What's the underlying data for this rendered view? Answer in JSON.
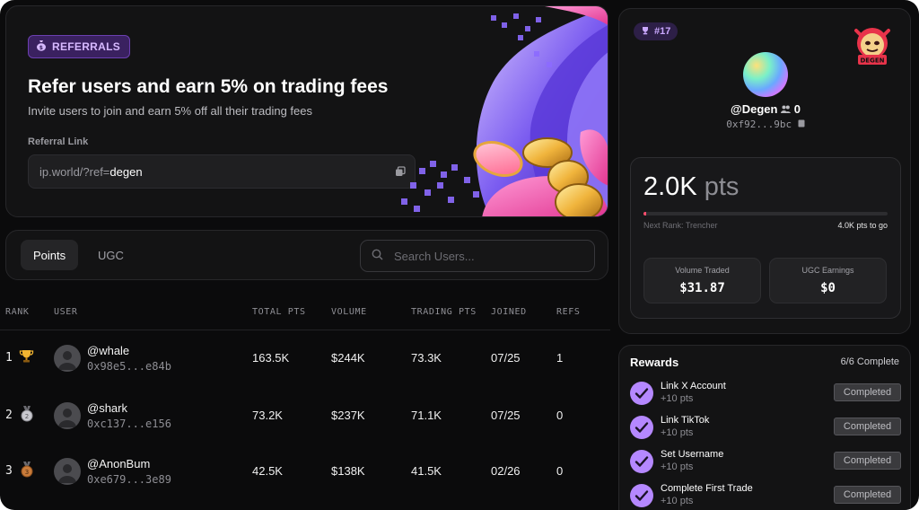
{
  "hero": {
    "badge": "REFERRALS",
    "title": "Refer users and earn 5% on trading fees",
    "subtitle": "Invite users to join and earn 5% off all their trading fees",
    "ref_label": "Referral Link",
    "ref_prefix": "ip.world/?ref=",
    "ref_code": "degen"
  },
  "toolbar": {
    "tabs": [
      {
        "label": "Points",
        "active": true
      },
      {
        "label": "UGC",
        "active": false
      }
    ],
    "search_placeholder": "Search Users..."
  },
  "table": {
    "headers": [
      "RANK",
      "USER",
      "TOTAL PTS",
      "VOLUME",
      "TRADING PTS",
      "JOINED",
      "REFS"
    ],
    "rows": [
      {
        "rank": "1",
        "medal": "trophy-icon",
        "name": "@whale",
        "address": "0x98e5...e84b",
        "total_pts": "163.5K",
        "volume": "$244K",
        "trading_pts": "73.3K",
        "joined": "07/25",
        "refs": "1"
      },
      {
        "rank": "2",
        "medal": "silver-medal-icon",
        "name": "@shark",
        "address": "0xc137...e156",
        "total_pts": "73.2K",
        "volume": "$237K",
        "trading_pts": "71.1K",
        "joined": "07/25",
        "refs": "0"
      },
      {
        "rank": "3",
        "medal": "bronze-medal-icon",
        "name": "@AnonBum",
        "address": "0xe679...3e89",
        "total_pts": "42.5K",
        "volume": "$138K",
        "trading_pts": "41.5K",
        "joined": "02/26",
        "refs": "0"
      }
    ]
  },
  "profile": {
    "rank": "#17",
    "mascot_label": "DEGEN",
    "name": "@Degen",
    "followers": "0",
    "address": "0xf92...9bc",
    "points_value": "2.0K",
    "points_unit": "pts",
    "progress_fraction": 0.01,
    "next_rank_label": "Next Rank: Trencher",
    "to_next": "4.0K pts to go",
    "stats": [
      {
        "label": "Volume Traded",
        "value": "$31.87"
      },
      {
        "label": "UGC Earnings",
        "value": "$0"
      }
    ]
  },
  "rewards": {
    "title": "Rewards",
    "count": "6/6 Complete",
    "items": [
      {
        "name": "Link X Account",
        "pts": "+10 pts",
        "status": "Completed"
      },
      {
        "name": "Link TikTok",
        "pts": "+10 pts",
        "status": "Completed"
      },
      {
        "name": "Set Username",
        "pts": "+10 pts",
        "status": "Completed"
      },
      {
        "name": "Complete First Trade",
        "pts": "+10 pts",
        "status": "Completed"
      }
    ]
  },
  "colors": {
    "accent": "#b588ff",
    "badge_bg": "#3a2160",
    "progress": "#ff4d6d"
  }
}
